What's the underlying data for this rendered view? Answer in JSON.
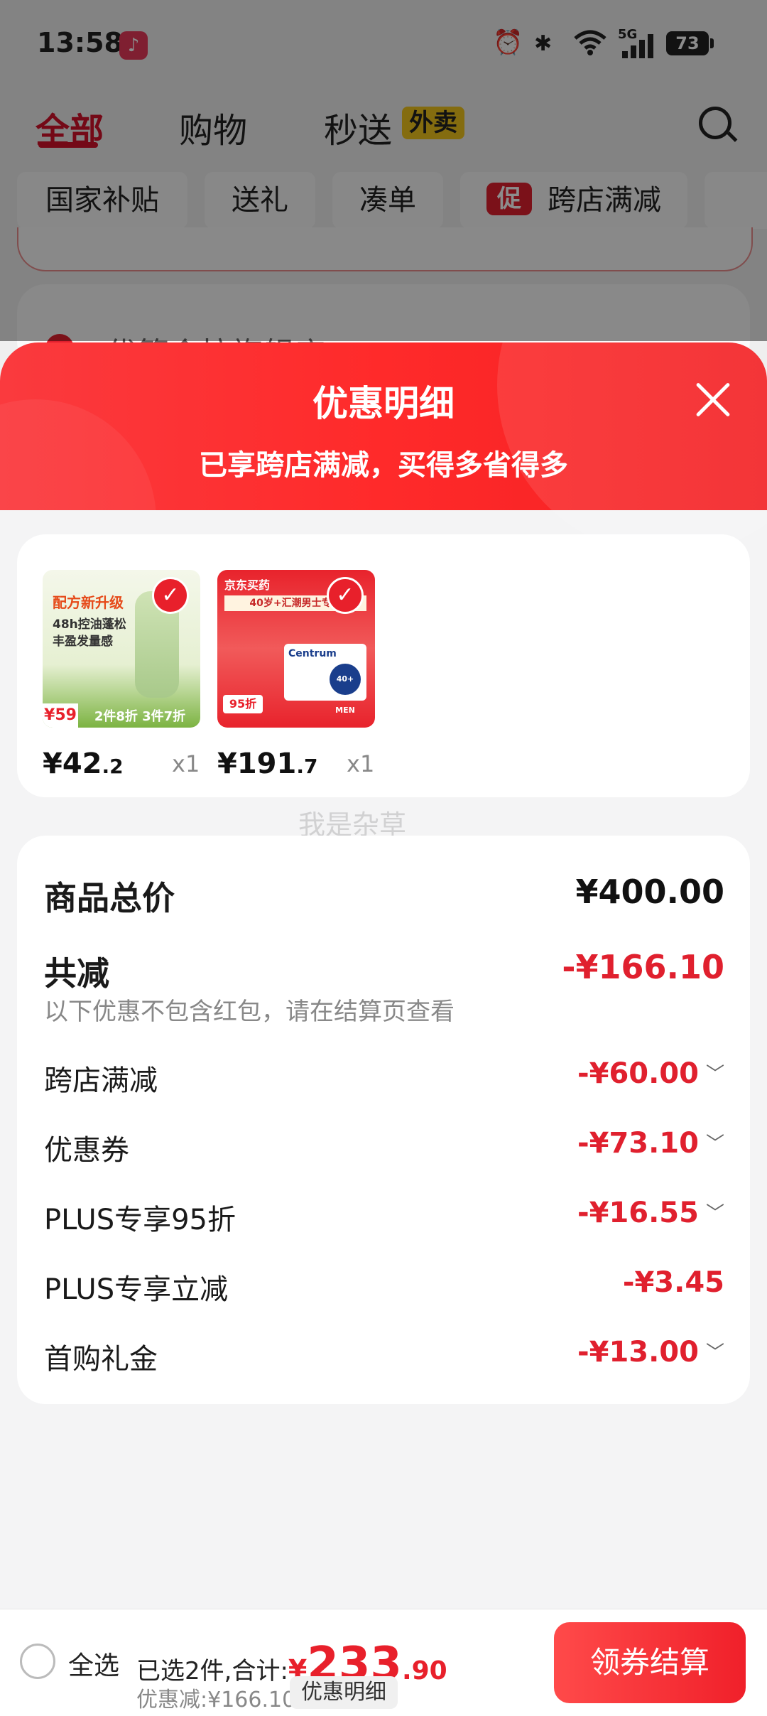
{
  "status_bar": {
    "time": "13:58",
    "network": "5G",
    "battery": "73"
  },
  "tabs": [
    {
      "label": "全部"
    },
    {
      "label": "购物"
    },
    {
      "label": "秒送"
    }
  ],
  "tab_badge": "外卖",
  "chips": [
    {
      "label": "国家补贴"
    },
    {
      "label": "送礼"
    },
    {
      "label": "凑单"
    },
    {
      "label": "跨店满减",
      "badge": "促"
    }
  ],
  "background_store_name": "优簇会拉旗舰店",
  "sheet": {
    "title": "优惠明细",
    "subtitle": "已享跨店满减，买得多省得多"
  },
  "products": [
    {
      "price_int": "¥42",
      "price_dec": ".2",
      "qty": "x1",
      "img_lines": [
        "配方新升级",
        "48h控油蓬松",
        "丰盈发量感",
        "¥59",
        "2件8折 3件7折"
      ]
    },
    {
      "price_int": "¥191",
      "price_dec": ".7",
      "qty": "x1",
      "img_lines": [
        "京东买药",
        "40岁+汇潮男士专研",
        "Centrum",
        "40+ MEN",
        "95折"
      ]
    }
  ],
  "watermark": "我是杂草",
  "details": {
    "total_label": "商品总价",
    "total_value": "¥400.00",
    "reduce_label": "共减",
    "reduce_value": "-¥166.10",
    "note": "以下优惠不包含红包，请在结算页查看",
    "items": [
      {
        "label": "跨店满减",
        "value": "-¥60.00",
        "chevron": true
      },
      {
        "label": "优惠券",
        "value": "-¥73.10",
        "chevron": true
      },
      {
        "label": "PLUS专享95折",
        "value": "-¥16.55",
        "chevron": true
      },
      {
        "label": "PLUS专享立减",
        "value": "-¥3.45",
        "chevron": false
      },
      {
        "label": "首购礼金",
        "value": "-¥13.00",
        "chevron": true
      }
    ]
  },
  "bottom": {
    "select_all": "全选",
    "summary_prefix": "已选2件,合计:",
    "currency": "¥",
    "total_int": "233",
    "total_dec": ".90",
    "discount": "优惠减:¥166.10",
    "detail_button": "优惠明细",
    "checkout_button": "领券结算"
  },
  "colors": {
    "accent": "#e0202e",
    "header": "#fa3a3e"
  }
}
